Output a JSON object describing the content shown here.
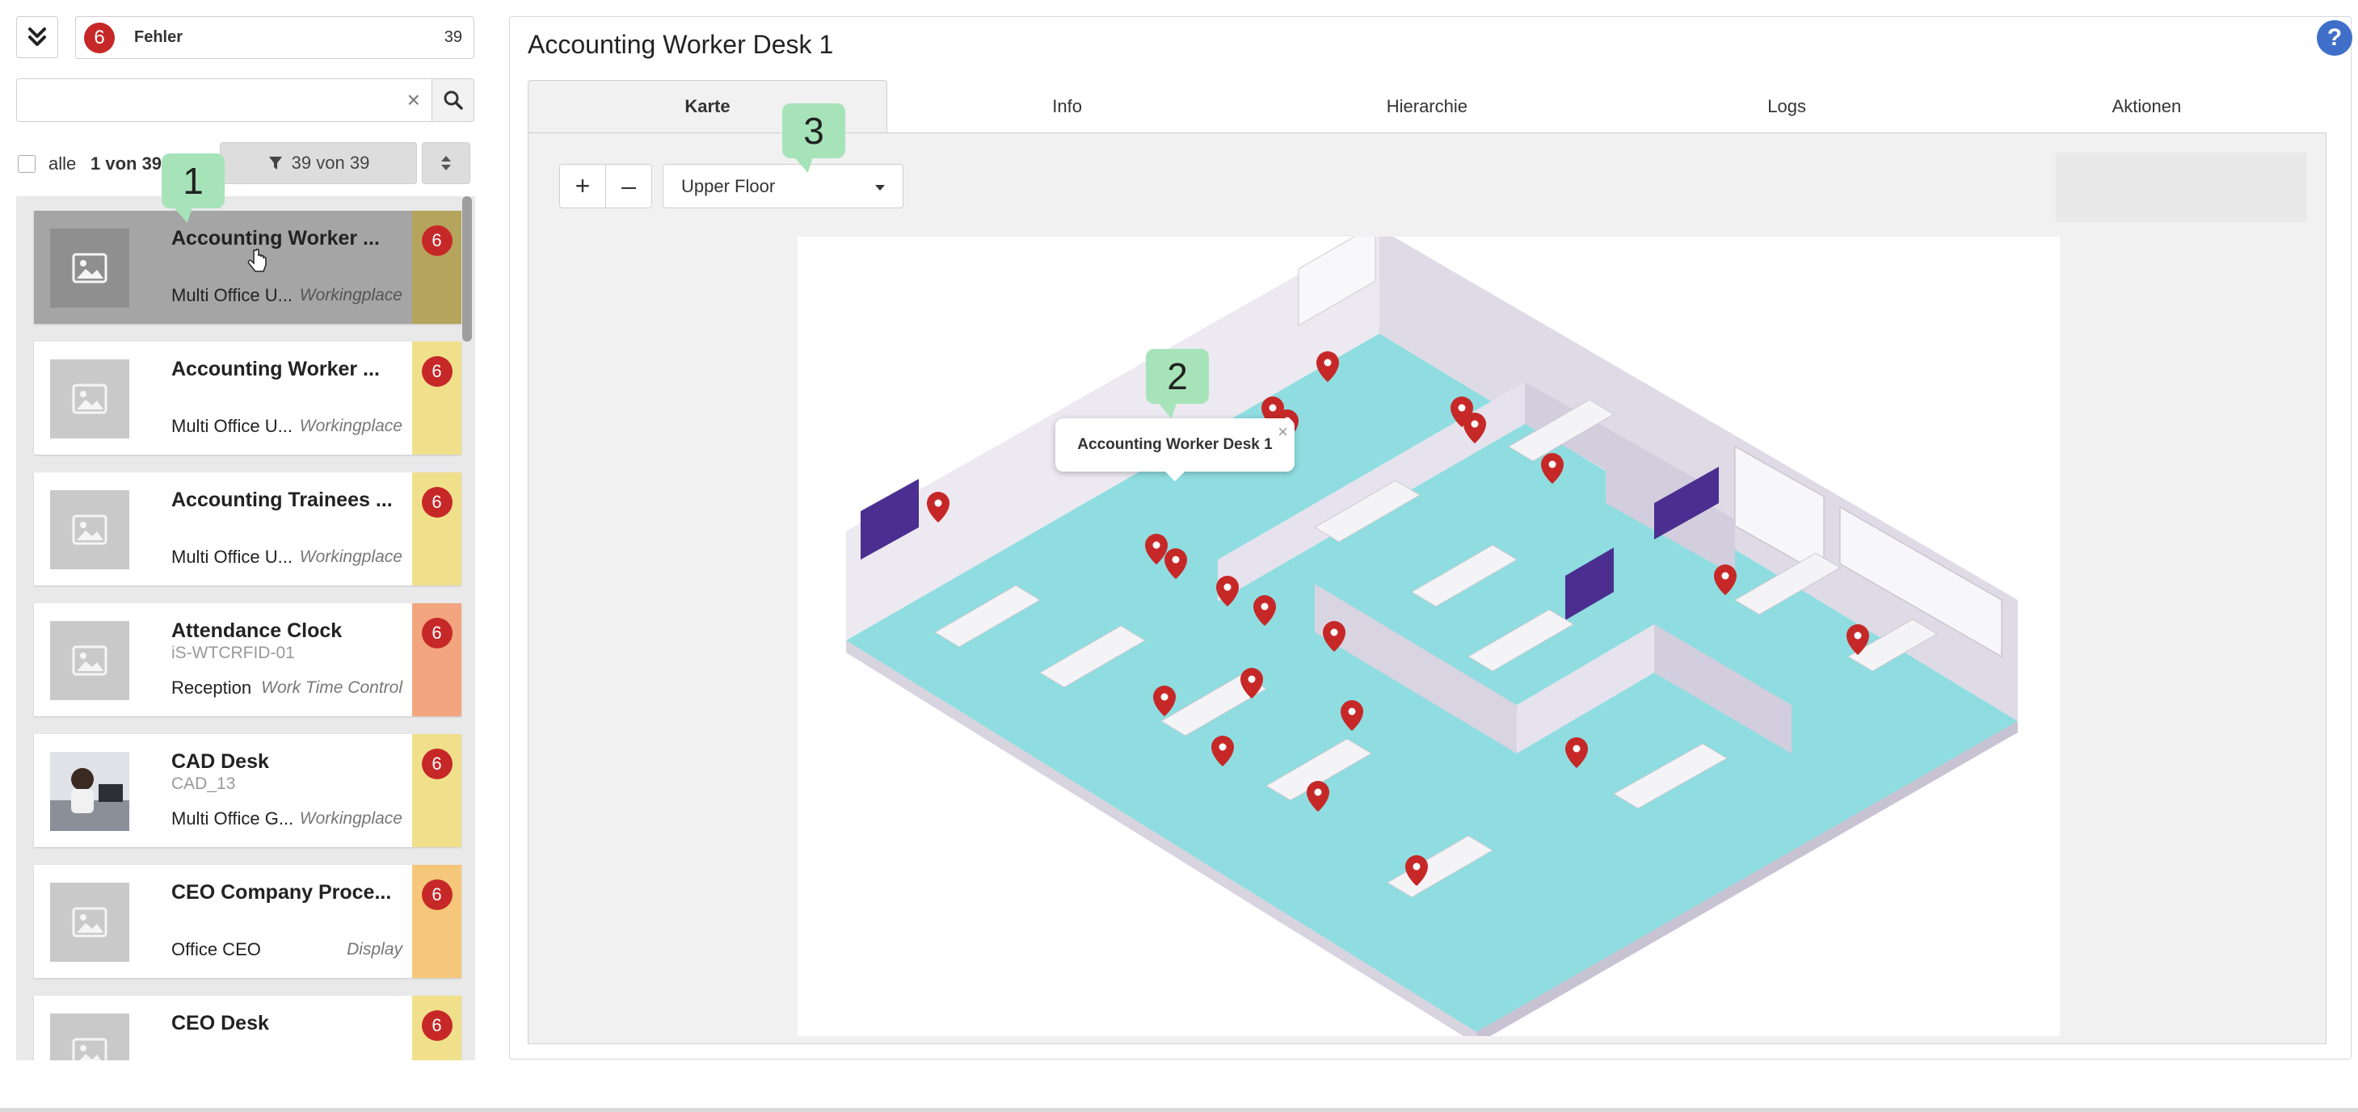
{
  "status": {
    "badge": "6",
    "label": "Fehler",
    "count": "39"
  },
  "search": {
    "placeholder": "",
    "clear": "×"
  },
  "selection": {
    "all_label": "alle",
    "count_label": "1 von 39"
  },
  "filter": {
    "label": "39 von 39"
  },
  "items": [
    {
      "title": "Accounting Worker ...",
      "subtitle": "",
      "location": "Multi Office U...",
      "type": "Workingplace",
      "badge": "6",
      "color": "#b5a55c",
      "selected": true
    },
    {
      "title": "Accounting Worker ...",
      "subtitle": "",
      "location": "Multi Office U...",
      "type": "Workingplace",
      "badge": "6",
      "color": "#f0e08c"
    },
    {
      "title": "Accounting Trainees ...",
      "subtitle": "",
      "location": "Multi Office U...",
      "type": "Workingplace",
      "badge": "6",
      "color": "#f0e08c"
    },
    {
      "title": "Attendance Clock",
      "subtitle": "iS-WTCRFID-01",
      "location": "Reception",
      "type": "Work Time Control",
      "badge": "6",
      "color": "#f2a57e"
    },
    {
      "title": "CAD Desk",
      "subtitle": "CAD_13",
      "location": "Multi Office G...",
      "type": "Workingplace",
      "badge": "6",
      "color": "#f0e08c",
      "photo": true
    },
    {
      "title": "CEO Company Proce...",
      "subtitle": "",
      "location": "Office CEO",
      "type": "Display",
      "badge": "6",
      "color": "#f6c77a"
    },
    {
      "title": "CEO Desk",
      "subtitle": "",
      "location": "",
      "type": "",
      "badge": "6",
      "color": "#f0e08c"
    }
  ],
  "main": {
    "title": "Accounting Worker Desk 1",
    "help": "?",
    "tabs": [
      "Karte",
      "Info",
      "Hierarchie",
      "Logs",
      "Aktionen"
    ],
    "zoom_in": "+",
    "zoom_out": "–",
    "floor": "Upper Floor",
    "popup": {
      "label": "Accounting Worker Desk 1",
      "close": "×"
    }
  },
  "callouts": [
    "1",
    "2",
    "3"
  ],
  "colors": {
    "error": "#c62828",
    "floor": "#8fdde0",
    "wall": "#e3e0ea",
    "accent": "#4b2e8f",
    "callout": "#a7e3b9"
  }
}
